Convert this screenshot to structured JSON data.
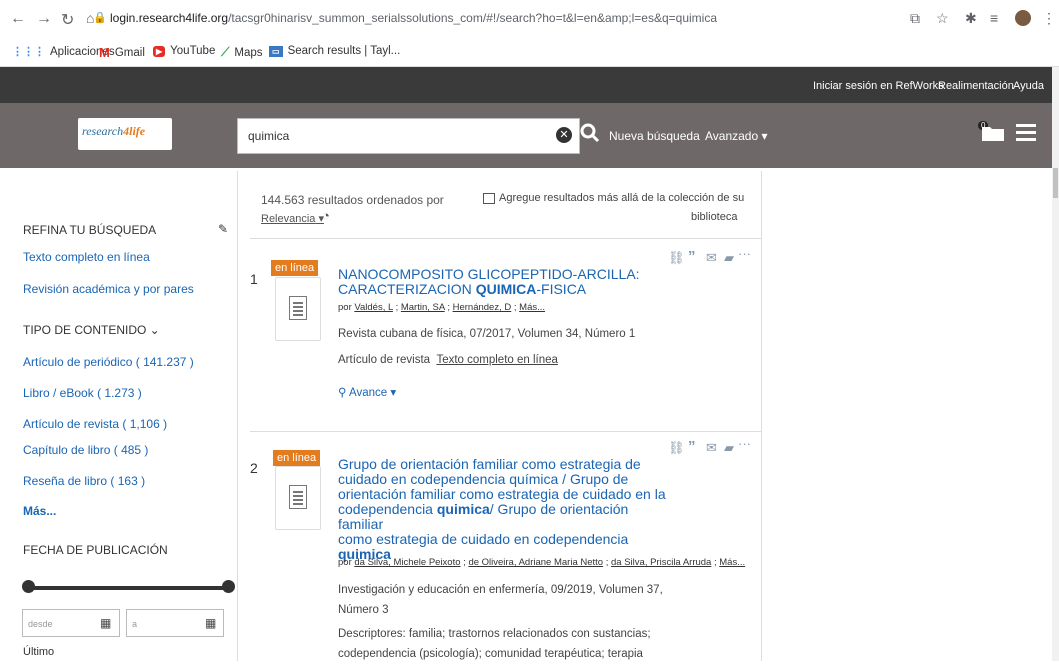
{
  "browser": {
    "url_host": "login.research4life.org",
    "url_path": "/tacsgr0hinarisv_summon_serialssolutions_com/#!/search?ho=t&l=en&amp;l=es&q=quimica",
    "bookmarks": [
      "Aplicaciones",
      "Gmail",
      "YouTube",
      "Maps",
      "Search results | Tayl..."
    ]
  },
  "topbar": {
    "refworks": "Iniciar sesión en RefWorks",
    "feedback": "Realimentación",
    "help": "Ayuda"
  },
  "header": {
    "logo_a": "research",
    "logo_b": "4",
    "logo_c": "life",
    "search_value": "quimica",
    "new_search": "Nueva búsqueda",
    "advanced": "Avanzado ▾",
    "folder_count": "0"
  },
  "sidebar": {
    "refine": "REFINA TU BÚSQUEDA",
    "filters": [
      "Texto completo en línea",
      "Revisión académica y por pares"
    ],
    "content_type_head": "TIPO DE CONTENIDO ⌄",
    "content_types": [
      {
        "label": "Artículo de periódico",
        "count": "( 141.237 )"
      },
      {
        "label": "Libro / eBook",
        "count": "( 1.273 )"
      },
      {
        "label": "Artículo de revista",
        "count": "( 1,106 )"
      },
      {
        "label": "Capítulo de libro",
        "count": "( 485 )"
      },
      {
        "label": "Reseña de libro",
        "count": "( 163 )"
      }
    ],
    "more": "Más...",
    "date_head": "FECHA DE PUBLICACIÓN",
    "from_placeholder": "desde",
    "to_placeholder": "a",
    "last": "Último"
  },
  "results": {
    "count_line": "144.563 resultados ordenados por",
    "sort": "Relevancia",
    "beyond": "Agregue resultados más allá de la colección de su",
    "beyond2": "biblioteca",
    "items": [
      {
        "num": "1",
        "badge": "en línea",
        "title_a": "NANOCOMPOSITO GLICOPEPTIDO-ARCILLA:",
        "title_b": "CARACTERIZACION ",
        "title_bold": "QUIMICA",
        "title_c": "-FISICA",
        "by": "por",
        "authors": [
          "Valdés, L",
          "Martin, SA",
          "Hernández, D",
          "Más..."
        ],
        "source": "Revista cubana de física, 07/2017, Volumen 34, Número 1",
        "type": "Artículo de revista",
        "fulltext": "Texto completo en línea",
        "preview": "Avance ▾"
      },
      {
        "num": "2",
        "badge": "en línea",
        "title_l1": "Grupo de orientación familiar como estrategia de",
        "title_l2": "cuidado en codependencia química / Grupo de",
        "title_l3": "orientación familiar como estrategia de cuidado en la",
        "title_l4a": "codependencia ",
        "title_l4b": "quimica",
        "title_l4c": "/ Grupo de orientación familiar",
        "title_l5": "como estrategia de cuidado en codependencia",
        "title_l6": "quimica",
        "by": "por",
        "authors": [
          "da Silva, Michele Peixoto",
          "de Oliveira, Adriane Maria Netto",
          "da Silva, Priscila Arruda",
          "Más..."
        ],
        "source_l1": "Investigación y educación en enfermería, 09/2019, Volumen 37,",
        "source_l2": "Número 3",
        "desc_l1": "Descriptores: familia; trastornos relacionados con sustancias;",
        "desc_l2": "codependencia (psicología); comunidad terapéutica; terapia"
      }
    ]
  },
  "colors": {
    "topbar": "#3a3a3a",
    "header": "#6e6968",
    "badge": "#e27c1e",
    "link": "#1a65b3"
  }
}
